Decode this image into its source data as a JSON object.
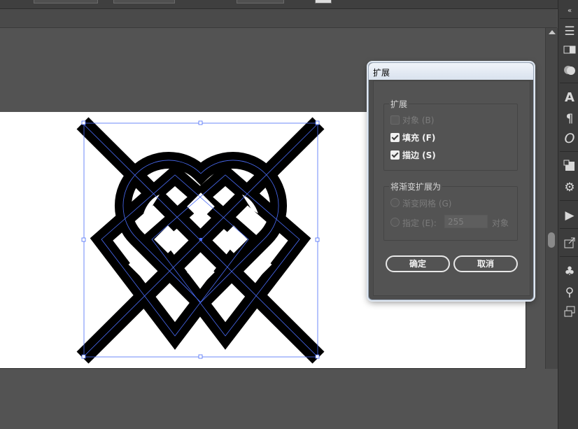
{
  "dialog": {
    "title": "扩展",
    "expand_group": {
      "legend": "扩展",
      "object_label": "对象 (B)",
      "object_checked": false,
      "object_enabled": false,
      "fill_label": "填充 (F)",
      "fill_checked": true,
      "stroke_label": "描边 (S)",
      "stroke_checked": true
    },
    "gradient_group": {
      "legend": "将渐变扩展为",
      "mesh_label": "渐变网格 (G)",
      "specify_label": "指定 (E):",
      "specify_value": "255",
      "specify_suffix": "对象"
    },
    "ok_label": "确定",
    "cancel_label": "取消"
  },
  "dock_icons": [
    "menu-icon",
    "gradient-icon",
    "transparency-icon",
    "character-icon",
    "paragraph-icon",
    "opentype-icon",
    "swatch-libraries-icon",
    "symbols-gear-icon",
    "play-actions-icon",
    "export-icon",
    "club-symbol-icon",
    "puppet-warp-icon",
    "artboards-icon"
  ],
  "colors": {
    "selection": "#4a6cf7",
    "artwork": "#000000",
    "dialog_border": "#dfe7f1"
  }
}
